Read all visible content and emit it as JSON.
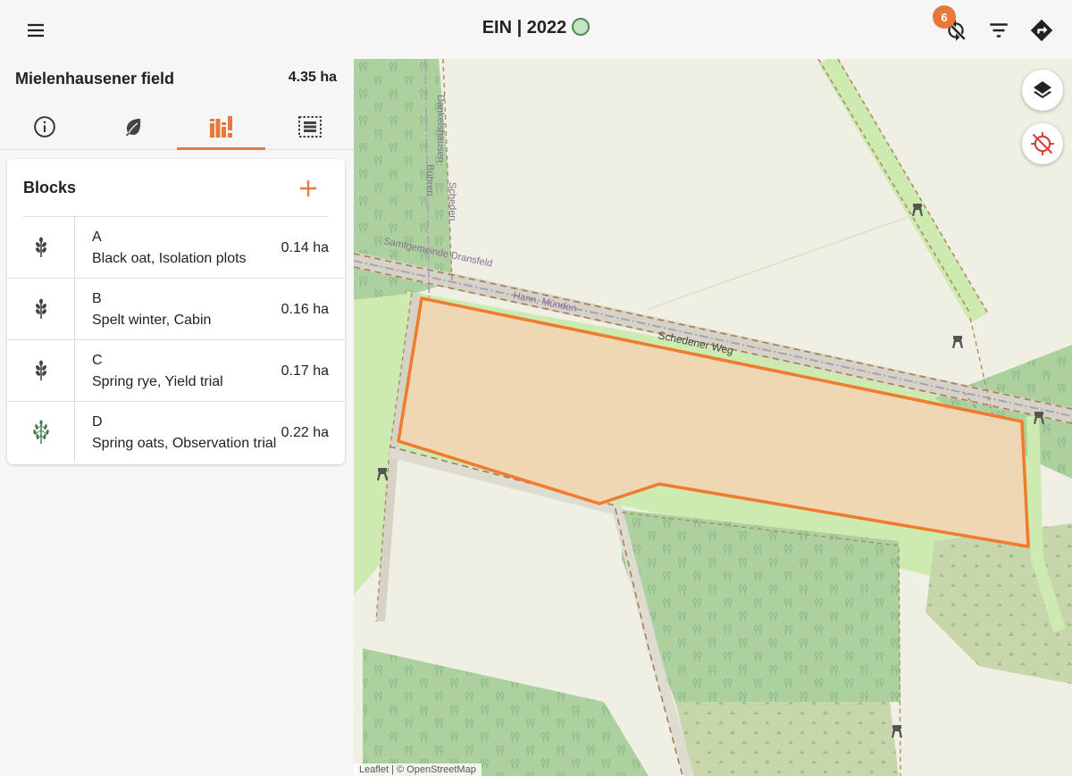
{
  "header": {
    "title": "EIN | 2022",
    "sync_count": "6",
    "status_color": "#c8e3c4",
    "accent_color": "#e8773a"
  },
  "field": {
    "name": "Mielenhausener field",
    "area": "4.35 ha"
  },
  "tabs": [
    {
      "icon": "info-icon",
      "active": false
    },
    {
      "icon": "leaf-icon",
      "active": false
    },
    {
      "icon": "blocks-icon",
      "active": true
    },
    {
      "icon": "plots-grid-icon",
      "active": false
    }
  ],
  "blocks": {
    "title": "Blocks",
    "items": [
      {
        "letter": "A",
        "description": "Black oat, Isolation plots",
        "area": "0.14 ha",
        "icon": "grain-icon"
      },
      {
        "letter": "B",
        "description": "Spelt winter, Cabin",
        "area": "0.16 ha",
        "icon": "grain-icon"
      },
      {
        "letter": "C",
        "description": "Spring rye, Yield trial",
        "area": "0.17 ha",
        "icon": "grain-icon"
      },
      {
        "letter": "D",
        "description": "Spring oats, Observation trial",
        "area": "0.22 ha",
        "icon": "oat-icon"
      }
    ]
  },
  "map": {
    "labels": {
      "road1": "Schedener Weg",
      "admin1": "Samtgemeinde Dransfeld",
      "admin2": "Hann. Münden",
      "road2": "Dankelshausen",
      "road3": "Scheden",
      "road4": "Bühren"
    },
    "attribution": "Leaflet | © OpenStreetMap"
  }
}
